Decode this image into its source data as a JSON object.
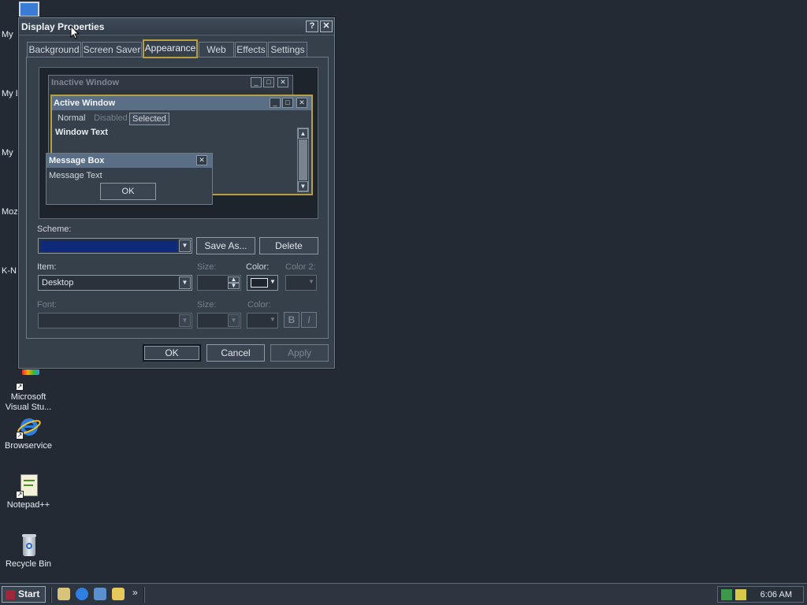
{
  "desktop": {
    "partial_labels": [
      "My",
      "My D",
      "My",
      "Moz",
      "K-N"
    ],
    "icons": [
      {
        "label_line1": "Microsoft",
        "label_line2": "Visual Stu...",
        "icon": "visual-studio-icon"
      },
      {
        "label_line1": "Browservice",
        "label_line2": "",
        "icon": "internet-explorer-icon"
      },
      {
        "label_line1": "Notepad++",
        "label_line2": "",
        "icon": "notepad-plus-plus-icon"
      },
      {
        "label_line1": "Recycle Bin",
        "label_line2": "",
        "icon": "recycle-bin-icon"
      }
    ]
  },
  "dialog": {
    "title": "Display Properties",
    "help_button": "?",
    "close_button": "✕",
    "tabs": [
      "Background",
      "Screen Saver",
      "Appearance",
      "Web",
      "Effects",
      "Settings"
    ],
    "active_tab": "Appearance",
    "preview": {
      "inactive_title": "Inactive Window",
      "active_title": "Active Window",
      "menu_normal": "Normal",
      "menu_disabled": "Disabled",
      "menu_selected": "Selected",
      "window_text": "Window Text",
      "message_box_title": "Message Box",
      "message_text": "Message Text",
      "ok_button": "OK"
    },
    "scheme_label": "Scheme:",
    "scheme_value": "",
    "scheme_color": "#0f2a7a",
    "save_as_button": "Save As...",
    "delete_button": "Delete",
    "item_label": "Item:",
    "item_value": "Desktop",
    "size_label": "Size:",
    "color_label": "Color:",
    "color2_label": "Color 2:",
    "font_label": "Font:",
    "font_size_label": "Size:",
    "font_color_label": "Color:",
    "bold_button": "B",
    "italic_button": "I",
    "ok_button": "OK",
    "cancel_button": "Cancel",
    "apply_button": "Apply"
  },
  "taskbar": {
    "start_label": "Start",
    "chevron": "»",
    "clock": "6:06 AM"
  }
}
